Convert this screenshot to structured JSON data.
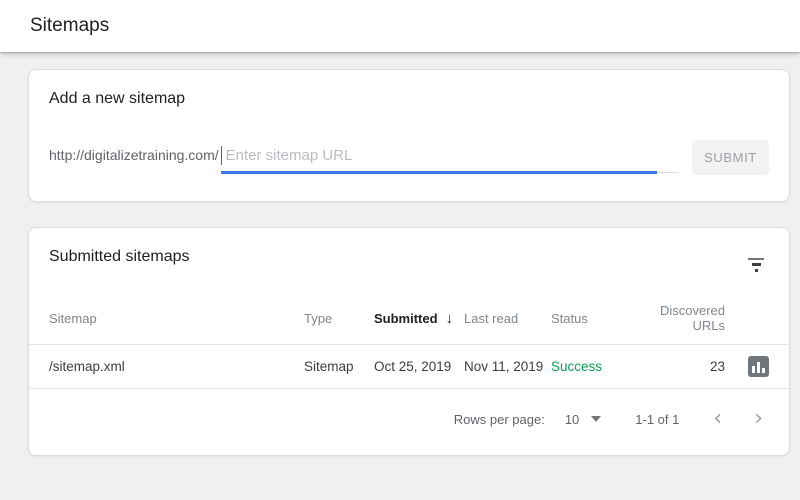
{
  "page": {
    "title": "Sitemaps"
  },
  "colors": {
    "accent_blue": "#3b78e7",
    "success_green": "#0f9d58",
    "card_border": "#dadce0",
    "body_background": "#f0f0f0"
  },
  "add_sitemap_card": {
    "heading": "Add a new sitemap",
    "url_prefix": "http://digitalizetraining.com/",
    "input_value": "",
    "input_placeholder": "Enter sitemap URL",
    "submit_label": "SUBMIT"
  },
  "submitted_card": {
    "heading": "Submitted sitemaps",
    "filter_icon": "filter-icon",
    "table": {
      "columns": [
        "Sitemap",
        "Type",
        "Submitted",
        "Last read",
        "Status",
        "Discovered URLs"
      ],
      "sorted_column": "Submitted",
      "sort_direction": "descending",
      "sort_arrow": "↓",
      "rows": [
        {
          "sitemap": "/sitemap.xml",
          "type": "Sitemap",
          "submitted": "Oct 25, 2019",
          "last_read": "Nov 11, 2019",
          "status": "Success",
          "discovered_urls": "23",
          "row_action_icon": "bar-chart-icon"
        }
      ]
    },
    "pagination": {
      "rows_per_page_label": "Rows per page:",
      "rows_per_page_value": "10",
      "range_label": "1-1 of 1",
      "prev_icon": "‹",
      "next_icon": "›"
    }
  }
}
